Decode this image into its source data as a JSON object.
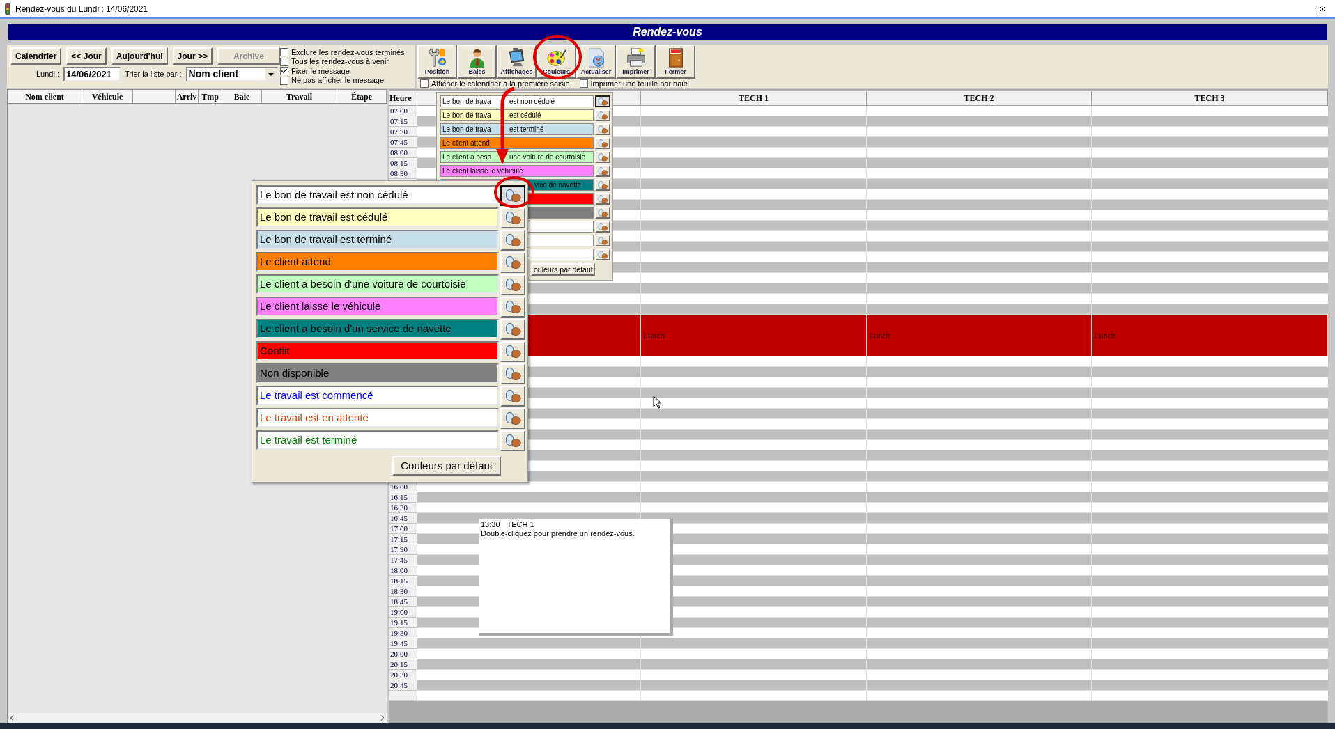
{
  "window": {
    "title": "Rendez-vous du Lundi : 14/06/2021"
  },
  "header": {
    "title": "Rendez-vous"
  },
  "nav_buttons": [
    {
      "label": "Calendrier",
      "disabled": false
    },
    {
      "label": "<< Jour",
      "disabled": false
    },
    {
      "label": "Aujourd'hui",
      "disabled": false
    },
    {
      "label": "Jour >>",
      "disabled": false
    },
    {
      "label": "Archive",
      "disabled": true
    }
  ],
  "date_row": {
    "day_label": "Lundi :",
    "date": "14/06/2021",
    "sort_label": "Trier la liste par :",
    "sort_value": "Nom client"
  },
  "options": [
    {
      "label": "Exclure les rendez-vous terminés",
      "checked": false
    },
    {
      "label": "Tous les rendez-vous à venir",
      "checked": false
    },
    {
      "label": "Fixer le message",
      "checked": true
    },
    {
      "label": "Ne pas afficher le message",
      "checked": false
    }
  ],
  "toolbar": [
    {
      "label": "Position",
      "kind": "wrench"
    },
    {
      "label": "Baies",
      "kind": "person"
    },
    {
      "label": "Affichages",
      "kind": "monitor"
    },
    {
      "label": "Couleurs",
      "kind": "palette"
    },
    {
      "label": "Actualiser",
      "kind": "globe"
    },
    {
      "label": "Imprimer",
      "kind": "printer"
    },
    {
      "label": "Fermer",
      "kind": "door"
    }
  ],
  "toolbar_options": [
    {
      "label": "Afficher le calendrier à la première saisie",
      "checked": false
    },
    {
      "label": "Imprimer une feuille par baie",
      "checked": false
    }
  ],
  "list": {
    "columns": [
      {
        "kind": "text",
        "label": "Nom client"
      },
      {
        "kind": "text",
        "label": "Véhicule"
      },
      {
        "kind": "blank"
      },
      {
        "kind": "text",
        "label": "Arriv"
      },
      {
        "kind": "text",
        "label": "Tmp"
      },
      {
        "kind": "text",
        "label": "Baie"
      },
      {
        "kind": "text",
        "label": "Travail"
      },
      {
        "kind": "text",
        "label": "Étape"
      }
    ]
  },
  "calendar": {
    "time_heading": "Heure",
    "columns": [
      "TECH 1",
      "TECH 2",
      "TECH 3"
    ],
    "rows": [
      {
        "kind": "slot",
        "time": "07:00"
      },
      {
        "kind": "slot",
        "time": "07:15"
      },
      {
        "kind": "slot",
        "time": "07:30"
      },
      {
        "kind": "slot",
        "time": "07:45"
      },
      {
        "kind": "slot",
        "time": "08:00"
      },
      {
        "kind": "slot",
        "time": "08:15"
      },
      {
        "kind": "slot",
        "time": "08:30"
      },
      {
        "kind": "slot"
      },
      {
        "kind": "slot"
      },
      {
        "kind": "slot"
      },
      {
        "kind": "slot"
      },
      {
        "kind": "slot"
      },
      {
        "kind": "slot"
      },
      {
        "kind": "slot"
      },
      {
        "kind": "slot"
      },
      {
        "kind": "slot"
      },
      {
        "kind": "slot"
      },
      {
        "kind": "slot"
      },
      {
        "kind": "slot"
      },
      {
        "kind": "slot"
      },
      {
        "kind": "lunch",
        "labels": [
          "Lunch",
          "Lunch",
          "Lunch"
        ]
      },
      {
        "kind": "slot"
      },
      {
        "kind": "slot"
      },
      {
        "kind": "slot"
      },
      {
        "kind": "slot"
      },
      {
        "kind": "slot"
      },
      {
        "kind": "slot"
      },
      {
        "kind": "slot"
      },
      {
        "kind": "slot"
      },
      {
        "kind": "slot"
      },
      {
        "kind": "slot"
      },
      {
        "kind": "slot"
      },
      {
        "kind": "slot"
      },
      {
        "kind": "slot",
        "time": "16:00"
      },
      {
        "kind": "slot",
        "time": "16:15"
      },
      {
        "kind": "slot",
        "time": "16:30"
      },
      {
        "kind": "slot",
        "time": "16:45"
      },
      {
        "kind": "slot",
        "time": "17:00"
      },
      {
        "kind": "slot",
        "time": "17:15"
      },
      {
        "kind": "slot",
        "time": "17:30"
      },
      {
        "kind": "slot",
        "time": "17:45"
      },
      {
        "kind": "slot",
        "time": "18:00"
      },
      {
        "kind": "slot",
        "time": "18:15"
      },
      {
        "kind": "slot",
        "time": "18:30"
      },
      {
        "kind": "slot",
        "time": "18:45"
      },
      {
        "kind": "slot",
        "time": "19:00"
      },
      {
        "kind": "slot",
        "time": "19:15"
      },
      {
        "kind": "slot",
        "time": "19:30"
      },
      {
        "kind": "slot",
        "time": "19:45"
      },
      {
        "kind": "slot",
        "time": "20:00"
      },
      {
        "kind": "slot",
        "time": "20:15"
      },
      {
        "kind": "slot",
        "time": "20:30"
      },
      {
        "kind": "slot",
        "time": "20:45"
      },
      {
        "kind": "slot"
      }
    ]
  },
  "tooltip": {
    "time": "13:30",
    "column": "TECH 1",
    "text": "Double-cliquez pour prendre un rendez-vous."
  },
  "color_panel_small": {
    "items": [
      {
        "kind": "split",
        "parts": [
          "Le bon de trava",
          "est non cédulé"
        ],
        "color": "#ffffff",
        "selected": true
      },
      {
        "kind": "split",
        "parts": [
          "Le bon de trava",
          "est cédulé"
        ],
        "color": "#ffffc0",
        "selected": false
      },
      {
        "kind": "split",
        "parts": [
          "Le bon de trava",
          "est terminé"
        ],
        "color": "#c6dfea",
        "selected": false
      },
      {
        "kind": "label",
        "label": "Le client attend",
        "color": "#ff8000",
        "selected": false
      },
      {
        "kind": "split",
        "parts": [
          "Le client a beso",
          "une voiture de courtoisie"
        ],
        "color": "#c0ffc0",
        "selected": false
      },
      {
        "kind": "label",
        "label": "Le client laisse le véhicule",
        "color": "#ff80ff",
        "selected": false
      },
      {
        "kind": "clipped",
        "label": "vice de navette",
        "color": "#008080",
        "selected": false
      },
      {
        "kind": "blank",
        "color": "#ff0000",
        "selected": false
      },
      {
        "kind": "blank",
        "color": "#808080",
        "selected": false
      },
      {
        "kind": "blank",
        "color": "#ffffff",
        "selected": false
      },
      {
        "kind": "blank",
        "color": "#ffffff",
        "selected": false
      },
      {
        "kind": "blank",
        "color": "#ffffff",
        "selected": false
      }
    ],
    "button": "ouleurs par défaut"
  },
  "color_panel": {
    "items": [
      {
        "label": {
          "text": "Le bon de travail est non cédulé"
        },
        "color": "#ffffff",
        "selected": true
      },
      {
        "label": {
          "text": "Le bon de travail est cédulé"
        },
        "color": "#ffffc0",
        "selected": false
      },
      {
        "label": {
          "text": "Le bon de travail est terminé"
        },
        "color": "#c6dfea",
        "selected": false
      },
      {
        "label": {
          "text": "Le client attend"
        },
        "color": "#ff8000",
        "selected": false
      },
      {
        "label": {
          "text": "Le client a besoin d'une voiture de courtoisie"
        },
        "color": "#c0ffc0",
        "selected": false
      },
      {
        "label": {
          "text": "Le client laisse le véhicule"
        },
        "color": "#ff80ff",
        "selected": false
      },
      {
        "label": {
          "text": "Le client a besoin d'un service de navette"
        },
        "color": "#008080",
        "selected": false
      },
      {
        "label": {
          "text": "Conflit"
        },
        "color": "#ff0000",
        "selected": false
      },
      {
        "label": {
          "text": "Non disponible"
        },
        "color": "#808080",
        "selected": false
      },
      {
        "label": {
          "text": "Le travail est commencé",
          "color": "#0000ff"
        },
        "color": "#ffffff",
        "selected": false
      },
      {
        "label": {
          "text": "Le travail est en attente",
          "color": "#e04010"
        },
        "color": "#ffffff",
        "selected": false
      },
      {
        "label": {
          "text": "Le travail est terminé",
          "color": "#008000"
        },
        "color": "#ffffff",
        "selected": false
      }
    ],
    "button": "Couleurs par défaut"
  }
}
